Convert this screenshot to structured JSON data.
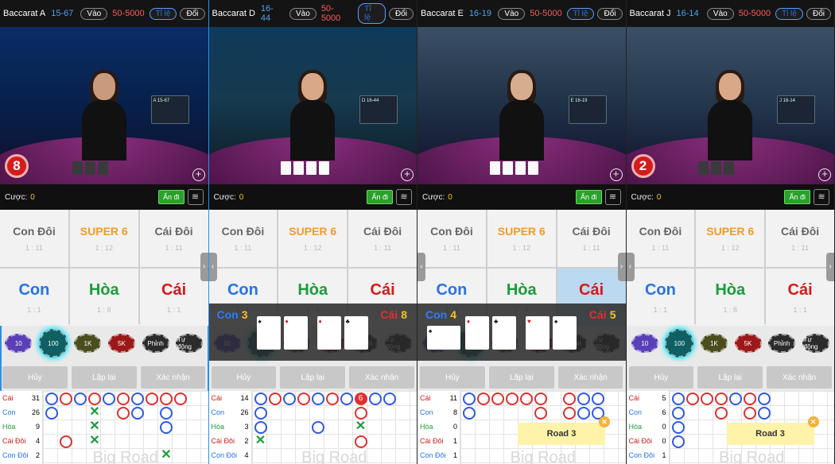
{
  "ui": {
    "enter_label": "Vào",
    "ratio_label": "Tỉ lệ",
    "switch_label": "Đổi",
    "limit": "50-5000",
    "bet_label": "Cược:",
    "bet_value": "0",
    "hide_label": "Ẩn đi",
    "cancel_label": "Hủy",
    "repeat_label": "Lặp lại",
    "confirm_label": "Xác nhận",
    "big_road_label": "Big Road",
    "road3_label": "Road 3",
    "bets": {
      "player_pair": "Con Đôi",
      "super6": "SUPER 6",
      "banker_pair": "Cái Đôi",
      "player": "Con",
      "tie": "Hòa",
      "banker": "Cái",
      "odds_pair": "1 : 11",
      "odds_super6": "1 : 12",
      "odds_player": "1 : 1",
      "odds_tie": "1 : 8",
      "odds_banker": "1 : 1"
    },
    "chips": [
      "10",
      "100",
      "1K",
      "5K",
      "Phỉnh",
      "Tự động"
    ],
    "stat_labels": [
      "Cái",
      "Con",
      "Hòa",
      "Cái Đôi",
      "Con Đôi"
    ]
  },
  "tables": [
    {
      "name": "Baccarat A",
      "nums": "15-67",
      "score": "8",
      "monitor": "A 15-67",
      "stats": [
        "31",
        "26",
        "9",
        "4",
        "2"
      ]
    },
    {
      "name": "Baccarat D",
      "nums": "16-44",
      "score": "",
      "monitor": "D 16-44",
      "stats": [
        "14",
        "26",
        "3",
        "2",
        "4"
      ],
      "overlay": {
        "player_label": "Con",
        "player_score": "3",
        "banker_label": "Cái",
        "banker_score": "8"
      }
    },
    {
      "name": "Baccarat E",
      "nums": "16-19",
      "score": "",
      "monitor": "E 16-19",
      "stats": [
        "11",
        "8",
        "0",
        "1",
        "1"
      ],
      "overlay": {
        "player_label": "Con",
        "player_score": "4",
        "banker_label": "Cái",
        "banker_score": "5"
      }
    },
    {
      "name": "Baccarat J",
      "nums": "16-14",
      "score": "2",
      "monitor": "J 16-14",
      "stats": [
        "5",
        "6",
        "0",
        "0",
        "1"
      ]
    }
  ],
  "colors": {
    "player": "#2672e6",
    "tie": "#1b9c3a",
    "banker": "#d21b1b",
    "super6": "#f59b1e",
    "highlight": "#2e8fe6"
  }
}
